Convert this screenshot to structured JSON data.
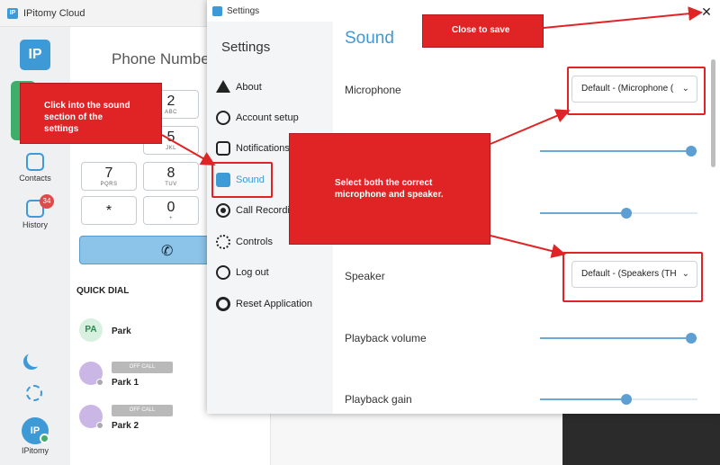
{
  "background_app": {
    "window_title": "IPitomy Cloud",
    "logo_text": "IP",
    "phone_number_label": "Phone Numbe",
    "keypad": [
      {
        "digit": "2",
        "letters": "ABC"
      },
      {
        "digit": "5",
        "letters": "JKL"
      },
      {
        "digit": "7",
        "letters": "PQRS"
      },
      {
        "digit": "8",
        "letters": "TUV"
      },
      {
        "digit": "*",
        "letters": ""
      },
      {
        "digit": "0",
        "letters": "+"
      }
    ],
    "nav": {
      "contacts": "Contacts",
      "history": "History",
      "history_badge": "34"
    },
    "quick_dial_title": "QUICK DIAL",
    "quick_dial": [
      {
        "initials": "PA",
        "name": "Park",
        "status": ""
      },
      {
        "initials": "",
        "name": "Park 1",
        "status": "OFF CALL"
      },
      {
        "initials": "",
        "name": "Park 2",
        "status": "OFF CALL"
      }
    ],
    "user": {
      "initials": "IP",
      "name": "IPitomy"
    }
  },
  "settings": {
    "window_title": "Settings",
    "sidebar_title": "Settings",
    "nav_items": [
      {
        "label": "About"
      },
      {
        "label": "Account setup"
      },
      {
        "label": "Notifications"
      },
      {
        "label": "Sound"
      },
      {
        "label": "Call Recording"
      },
      {
        "label": "Controls"
      },
      {
        "label": "Log out"
      },
      {
        "label": "Reset Application"
      }
    ],
    "active_item": "Sound",
    "content": {
      "heading": "Sound",
      "microphone_label": "Microphone",
      "microphone_value": "Default - (Microphone (",
      "speaker_label": "Speaker",
      "speaker_value": "Default - (Speakers (TH",
      "playback_volume_label": "Playback volume",
      "playback_gain_label": "Playback gain",
      "sliders": {
        "mic_volume": 1.0,
        "mic_gain": 0.55,
        "playback_volume": 1.0,
        "playback_gain": 0.55
      }
    }
  },
  "annotations": {
    "close_note": "Close to save",
    "sound_note": [
      "Click into the sound",
      "section of the",
      "settings"
    ],
    "select_note": [
      "Select both the correct",
      "microphone and speaker."
    ]
  },
  "colors": {
    "accent": "#3d9ad6",
    "annotation_red": "#e02426",
    "online_green": "#3fae6a"
  }
}
